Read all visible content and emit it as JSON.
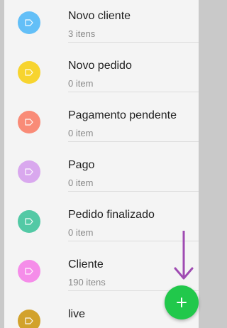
{
  "labels": [
    {
      "title": "Novo cliente",
      "subtitle": "3 itens",
      "color": "#63bff7"
    },
    {
      "title": "Novo pedido",
      "subtitle": "0 item",
      "color": "#f7d42f"
    },
    {
      "title": "Pagamento pendente",
      "subtitle": "0 item",
      "color": "#f98b77"
    },
    {
      "title": "Pago",
      "subtitle": "0 item",
      "color": "#d9a8ee"
    },
    {
      "title": "Pedido finalizado",
      "subtitle": "0 item",
      "color": "#53c9a5"
    },
    {
      "title": "Cliente",
      "subtitle": "190 itens",
      "color": "#f58de9"
    },
    {
      "title": "live",
      "subtitle": "",
      "color": "#d2a22c"
    }
  ],
  "fab": {
    "icon": "plus-icon",
    "color": "#21c84b"
  },
  "annotation": {
    "icon": "arrow-down-icon",
    "color": "#9f4bb2"
  }
}
